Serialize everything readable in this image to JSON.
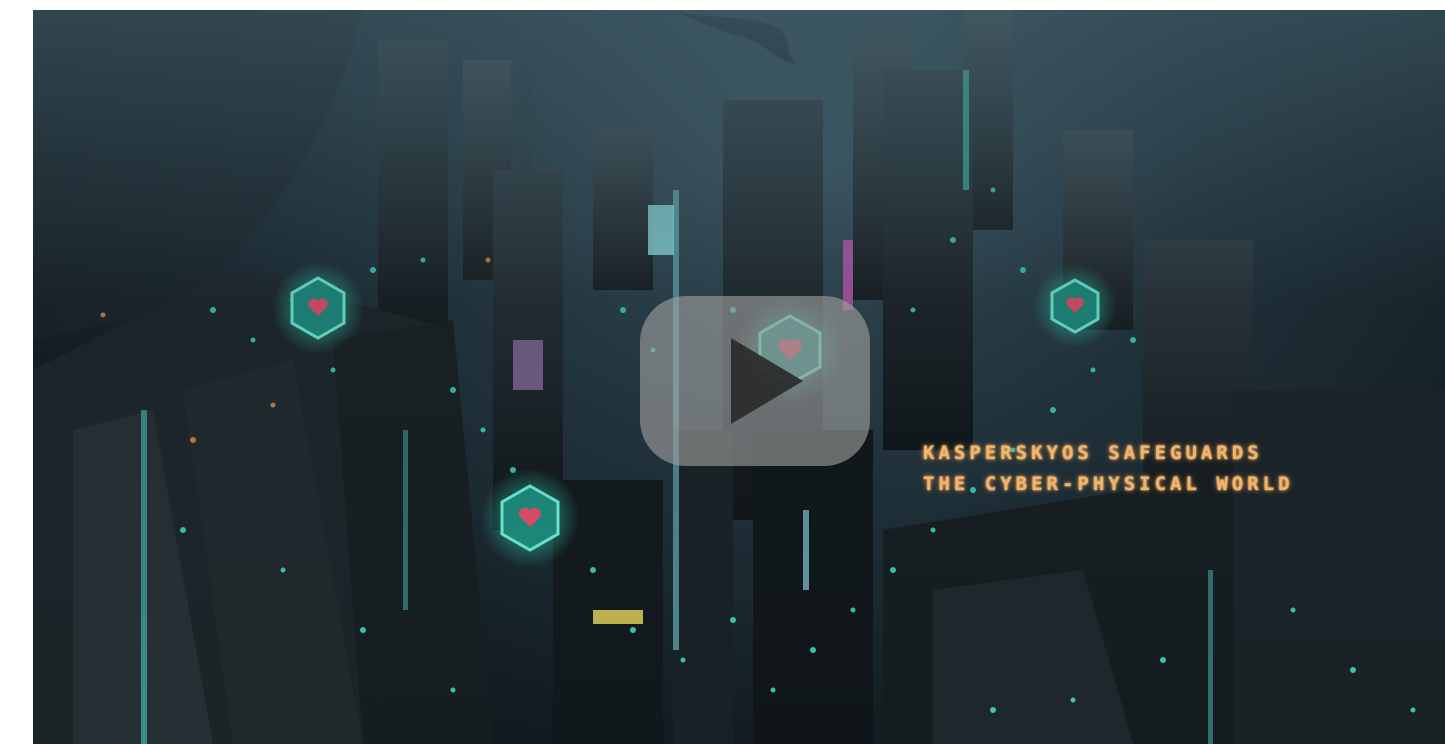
{
  "video": {
    "caption_line1": "KASPERSKYOS SAFEGUARDS",
    "caption_line2": "THE CYBER-PHYSICAL WORLD",
    "play_icon": "play-icon",
    "shield_icon": "heart-shield-icon"
  },
  "colors": {
    "accent_neon": "#3fe8c8",
    "caption_glow": "#f4b46a",
    "heart": "#e8506a"
  }
}
